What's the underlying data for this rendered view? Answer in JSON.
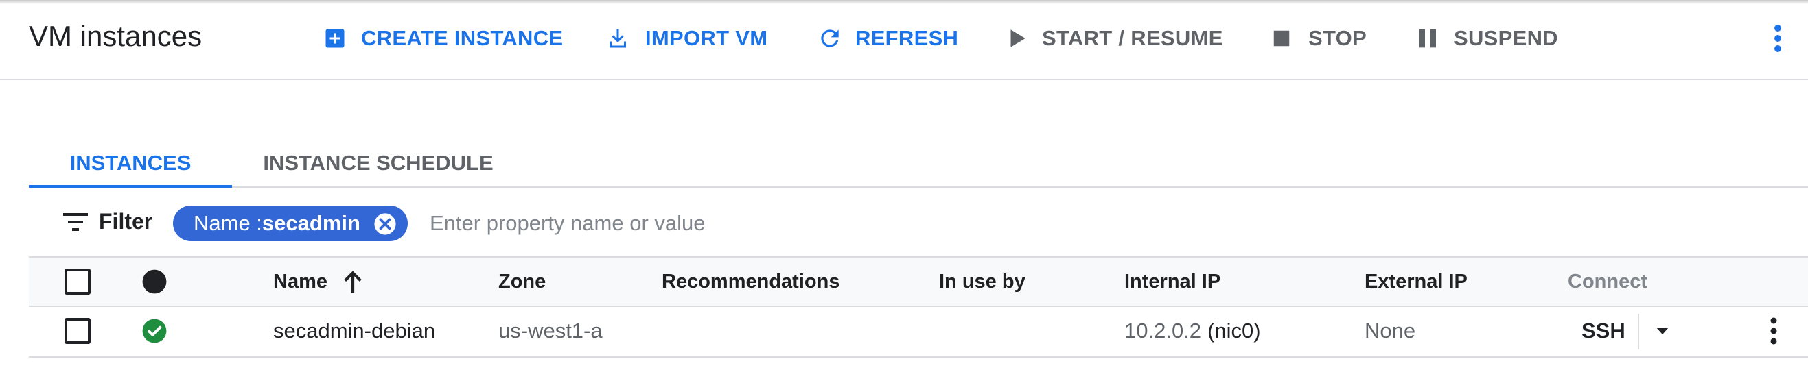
{
  "header": {
    "title": "VM instances",
    "toolbar": {
      "create_instance": "CREATE INSTANCE",
      "import_vm": "IMPORT VM",
      "refresh": "REFRESH",
      "start_resume": "START / RESUME",
      "stop": "STOP",
      "suspend": "SUSPEND"
    }
  },
  "tabs": [
    {
      "label": "INSTANCES",
      "selected": true
    },
    {
      "label": "INSTANCE SCHEDULE",
      "selected": false
    }
  ],
  "filter": {
    "label": "Filter",
    "chip": {
      "key": "Name : ",
      "value": "secadmin"
    },
    "placeholder": "Enter property name or value"
  },
  "table": {
    "columns": {
      "name": "Name",
      "zone": "Zone",
      "recommendations": "Recommendations",
      "in_use_by": "In use by",
      "internal_ip": "Internal IP",
      "external_ip": "External IP",
      "connect": "Connect"
    },
    "rows": [
      {
        "status": "running",
        "name": "secadmin-debian",
        "zone": "us-west1-a",
        "recommendations": "",
        "in_use_by": "",
        "internal_ip": "10.2.0.2",
        "internal_ip_nic": "(nic0)",
        "external_ip": "None",
        "connect": "SSH"
      }
    ]
  },
  "colors": {
    "accent": "#1a73e8",
    "chip": "#3367d6",
    "status_ok": "#1e8e3e",
    "disabled": "#5f6368",
    "divider": "#dadce0"
  },
  "icons": {
    "create": "add-box-icon",
    "import": "download-icon",
    "refresh": "refresh-icon",
    "start": "play-icon",
    "stop": "stop-icon",
    "suspend": "pause-icon",
    "more": "more-vert-icon",
    "filter": "filter-list-icon",
    "chip_close": "cancel-icon",
    "status_column": "status-dot-icon",
    "status_ok": "check-circle-icon",
    "sort": "arrow-up-icon",
    "ssh_menu": "arrow-drop-down-icon",
    "row_menu": "more-vert-icon"
  }
}
